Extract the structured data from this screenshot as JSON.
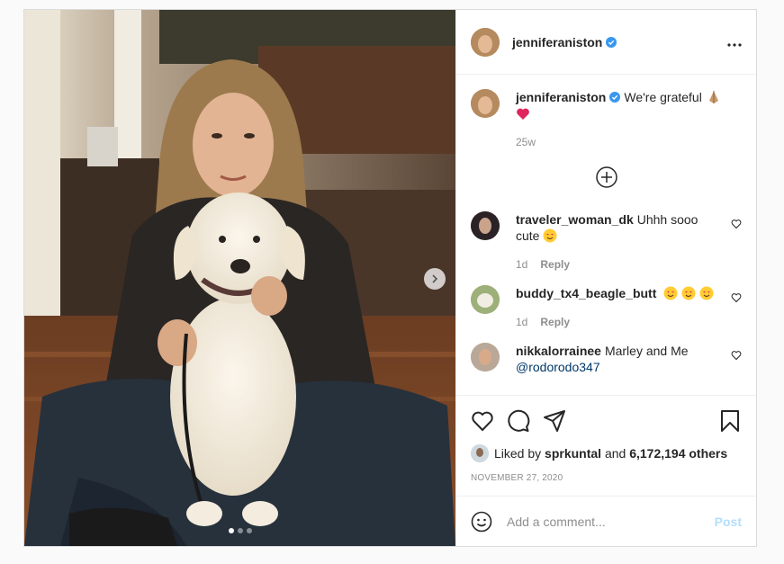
{
  "author": {
    "username": "jenniferaniston",
    "verified": true
  },
  "caption": {
    "text": "We're grateful",
    "age": "25w"
  },
  "comments": [
    {
      "username": "traveler_woman_dk",
      "text": "Uhhh sooo cute",
      "age": "1d",
      "reply_label": "Reply",
      "emoji": "heart-eyes"
    },
    {
      "username": "buddy_tx4_beagle_butt",
      "text": "",
      "age": "1d",
      "reply_label": "Reply",
      "emoji": "heart-eyes x3"
    },
    {
      "username": "nikkalorrainee",
      "text": "Marley and Me",
      "mention": "@rodorodo347"
    }
  ],
  "likes": {
    "prefix": "Liked by",
    "user": "sprkuntal",
    "joiner": "and",
    "others": "6,172,194 others"
  },
  "date": "NOVEMBER 27, 2020",
  "add_comment": {
    "placeholder": "Add a comment...",
    "post_label": "Post"
  },
  "carousel": {
    "count": 3,
    "active": 1
  },
  "colors": {
    "link": "#00376b",
    "verified": "#3897f0",
    "muted": "#8e8e8e",
    "post_disabled": "#b2dffc"
  },
  "icons": [
    "more-icon",
    "verified-icon",
    "load-more-icon",
    "heart-icon",
    "comment-icon",
    "share-icon",
    "bookmark-icon",
    "emoji-icon",
    "chevron-right-icon"
  ]
}
